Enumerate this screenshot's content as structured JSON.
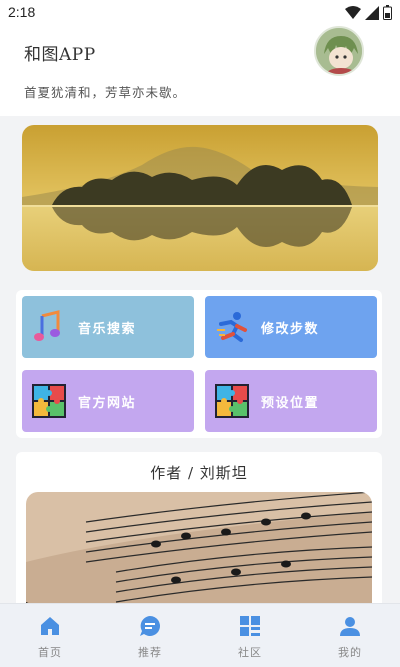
{
  "status": {
    "time": "2:18"
  },
  "header": {
    "title": "和图APP",
    "subtitle": "首夏犹清和，芳草亦未歇。"
  },
  "menu": {
    "items": [
      {
        "label": "音乐搜索",
        "icon": "music-note-icon",
        "color": "#8ec1dc"
      },
      {
        "label": "修改步数",
        "icon": "running-figure-icon",
        "color": "#6ea3ef"
      },
      {
        "label": "官方网站",
        "icon": "puzzle-icon",
        "color": "#c3a7ef"
      },
      {
        "label": "预设位置",
        "icon": "puzzle-icon",
        "color": "#c3a7ef"
      }
    ]
  },
  "author": {
    "title": "作者 / 刘斯坦"
  },
  "nav": {
    "items": [
      {
        "label": "首页",
        "icon": "home-icon"
      },
      {
        "label": "推荐",
        "icon": "chat-bubble-icon"
      },
      {
        "label": "社区",
        "icon": "grid-icon"
      },
      {
        "label": "我的",
        "icon": "user-icon"
      }
    ],
    "active_color": "#4a90e2"
  }
}
